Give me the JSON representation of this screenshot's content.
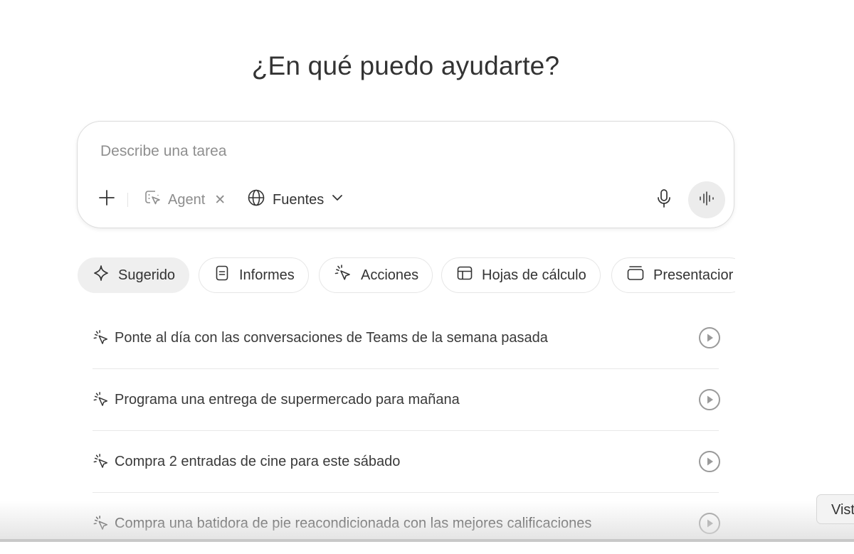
{
  "heading": "¿En qué puedo ayudarte?",
  "composer": {
    "placeholder": "Describe una tarea",
    "value": "",
    "agent_label": "Agent",
    "agent_remove": "✕",
    "sources_label": "Fuentes"
  },
  "categories": [
    {
      "label": "Sugerido",
      "icon": "sparkle-icon",
      "active": true
    },
    {
      "label": "Informes",
      "icon": "document-icon",
      "active": false
    },
    {
      "label": "Acciones",
      "icon": "agent-cursor-icon",
      "active": false
    },
    {
      "label": "Hojas de cálculo",
      "icon": "table-icon",
      "active": false
    },
    {
      "label": "Presentacior",
      "icon": "slides-icon",
      "active": false
    }
  ],
  "suggestions": [
    {
      "text": "Ponte al día con las conversaciones de Teams de la semana pasada"
    },
    {
      "text": "Programa una entrega de supermercado para mañana"
    },
    {
      "text": "Compra 2 entradas de cine para este sábado"
    },
    {
      "text": "Compra una batidora de pie reacondicionada con las mejores calificaciones"
    }
  ],
  "tooltip": "Vist",
  "colors": {
    "text": "#333333",
    "muted": "#8d8d8d",
    "chip_active_bg": "#efefef",
    "voice_button_bg": "#ececec",
    "border": "#dcdcdc"
  }
}
